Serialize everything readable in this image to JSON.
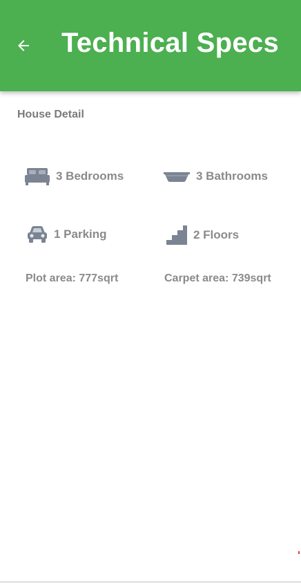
{
  "header": {
    "title": "Technical Specs",
    "back_icon": "arrow-left-icon",
    "color": "#4caf50"
  },
  "section": {
    "title": "House Detail"
  },
  "specs": {
    "bedrooms": {
      "label": "3 Bedrooms",
      "icon": "bed-icon"
    },
    "bathrooms": {
      "label": "3 Bathrooms",
      "icon": "bathtub-icon"
    },
    "parking": {
      "label": "1 Parking",
      "icon": "car-icon"
    },
    "floors": {
      "label": "2 Floors",
      "icon": "stairs-icon"
    }
  },
  "areas": {
    "plot": "Plot area: 777sqrt",
    "carpet": "Carpet area: 739sqrt"
  }
}
